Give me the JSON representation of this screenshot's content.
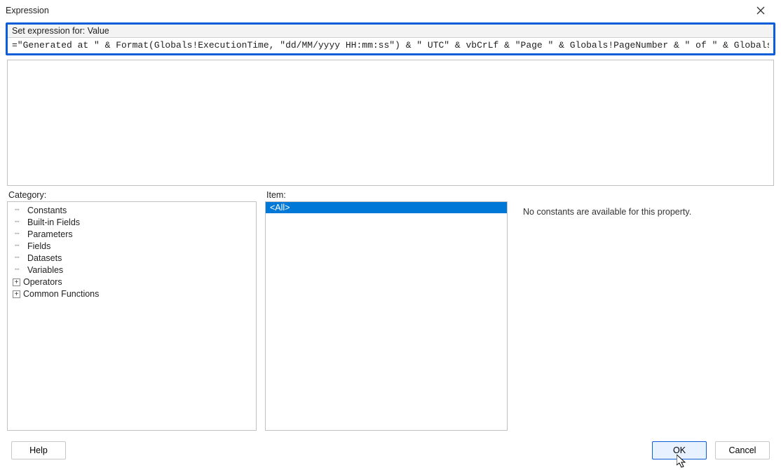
{
  "window": {
    "title": "Expression"
  },
  "expression": {
    "header": "Set expression for: Value",
    "value": "=\"Generated at \" & Format(Globals!ExecutionTime, \"dd/MM/yyyy HH:mm:ss\") & \" UTC\" & vbCrLf & \"Page \" & Globals!PageNumber & \" of \" & Globals!TotalPages"
  },
  "labels": {
    "category": "Category:",
    "item": "Item:"
  },
  "category_tree": [
    {
      "label": "Constants",
      "expandable": false
    },
    {
      "label": "Built-in Fields",
      "expandable": false
    },
    {
      "label": "Parameters",
      "expandable": false
    },
    {
      "label": "Fields",
      "expandable": false
    },
    {
      "label": "Datasets",
      "expandable": false
    },
    {
      "label": "Variables",
      "expandable": false
    },
    {
      "label": "Operators",
      "expandable": true
    },
    {
      "label": "Common Functions",
      "expandable": true
    }
  ],
  "item_list": {
    "items": [
      "<All>"
    ],
    "selected_index": 0
  },
  "description": "No constants are available for this property.",
  "buttons": {
    "help": "Help",
    "ok": "OK",
    "cancel": "Cancel"
  }
}
